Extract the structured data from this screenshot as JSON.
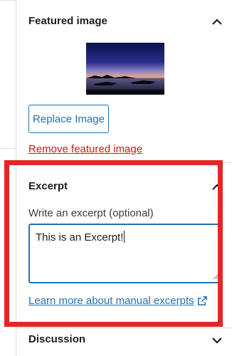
{
  "featured_image": {
    "title": "Featured image",
    "replace_label": "Replace Image",
    "remove_label": "Remove featured image"
  },
  "excerpt": {
    "title": "Excerpt",
    "field_label": "Write an excerpt (optional)",
    "value": "This is an Excerpt!",
    "learn_more": "Learn more about manual excerpts"
  },
  "discussion": {
    "title": "Discussion"
  },
  "colors": {
    "link": "#2271b1",
    "destructive": "#cc1818",
    "highlight": "#e32626"
  },
  "icons": {
    "featured_toggle": "chevron-up-icon",
    "excerpt_toggle": "chevron-up-icon",
    "discussion_toggle": "chevron-down-icon",
    "external": "external-link-icon"
  }
}
